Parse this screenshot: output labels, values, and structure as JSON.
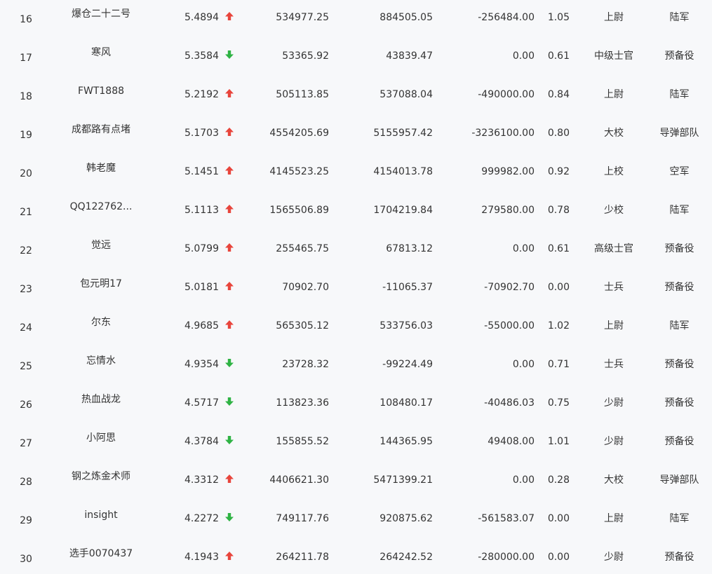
{
  "colors": {
    "up": "#e8453c",
    "down": "#2fb344",
    "text": "#333333",
    "background": "#f7f8fa"
  },
  "rows": [
    {
      "rank": "16",
      "name": "爆仓二十二号",
      "ratio": "5.4894",
      "trend": "up",
      "v1": "534977.25",
      "v2": "884505.05",
      "v3": "-256484.00",
      "v4": "1.05",
      "military_rank": "上尉",
      "branch": "陆军"
    },
    {
      "rank": "17",
      "name": "寒风",
      "ratio": "5.3584",
      "trend": "down",
      "v1": "53365.92",
      "v2": "43839.47",
      "v3": "0.00",
      "v4": "0.61",
      "military_rank": "中级士官",
      "branch": "预备役"
    },
    {
      "rank": "18",
      "name": "FWT1888",
      "ratio": "5.2192",
      "trend": "up",
      "v1": "505113.85",
      "v2": "537088.04",
      "v3": "-490000.00",
      "v4": "0.84",
      "military_rank": "上尉",
      "branch": "陆军"
    },
    {
      "rank": "19",
      "name": "成都路有点堵",
      "ratio": "5.1703",
      "trend": "up",
      "v1": "4554205.69",
      "v2": "5155957.42",
      "v3": "-3236100.00",
      "v4": "0.80",
      "military_rank": "大校",
      "branch": "导弹部队"
    },
    {
      "rank": "20",
      "name": "韩老魔",
      "ratio": "5.1451",
      "trend": "up",
      "v1": "4145523.25",
      "v2": "4154013.78",
      "v3": "999982.00",
      "v4": "0.92",
      "military_rank": "上校",
      "branch": "空军"
    },
    {
      "rank": "21",
      "name": "QQ122762...",
      "ratio": "5.1113",
      "trend": "up",
      "v1": "1565506.89",
      "v2": "1704219.84",
      "v3": "279580.00",
      "v4": "0.78",
      "military_rank": "少校",
      "branch": "陆军"
    },
    {
      "rank": "22",
      "name": "觉远",
      "ratio": "5.0799",
      "trend": "up",
      "v1": "255465.75",
      "v2": "67813.12",
      "v3": "0.00",
      "v4": "0.61",
      "military_rank": "高级士官",
      "branch": "预备役"
    },
    {
      "rank": "23",
      "name": "包元明17",
      "ratio": "5.0181",
      "trend": "up",
      "v1": "70902.70",
      "v2": "-11065.37",
      "v3": "-70902.70",
      "v4": "0.00",
      "military_rank": "士兵",
      "branch": "预备役"
    },
    {
      "rank": "24",
      "name": "尔东",
      "ratio": "4.9685",
      "trend": "up",
      "v1": "565305.12",
      "v2": "533756.03",
      "v3": "-55000.00",
      "v4": "1.02",
      "military_rank": "上尉",
      "branch": "陆军"
    },
    {
      "rank": "25",
      "name": "忘情水",
      "ratio": "4.9354",
      "trend": "down",
      "v1": "23728.32",
      "v2": "-99224.49",
      "v3": "0.00",
      "v4": "0.71",
      "military_rank": "士兵",
      "branch": "预备役"
    },
    {
      "rank": "26",
      "name": "热血战龙",
      "ratio": "4.5717",
      "trend": "down",
      "v1": "113823.36",
      "v2": "108480.17",
      "v3": "-40486.03",
      "v4": "0.75",
      "military_rank": "少尉",
      "branch": "预备役"
    },
    {
      "rank": "27",
      "name": "小阿思",
      "ratio": "4.3784",
      "trend": "down",
      "v1": "155855.52",
      "v2": "144365.95",
      "v3": "49408.00",
      "v4": "1.01",
      "military_rank": "少尉",
      "branch": "预备役"
    },
    {
      "rank": "28",
      "name": "钢之炼金术师",
      "ratio": "4.3312",
      "trend": "up",
      "v1": "4406621.30",
      "v2": "5471399.21",
      "v3": "0.00",
      "v4": "0.28",
      "military_rank": "大校",
      "branch": "导弹部队"
    },
    {
      "rank": "29",
      "name": "insight",
      "ratio": "4.2272",
      "trend": "down",
      "v1": "749117.76",
      "v2": "920875.62",
      "v3": "-561583.07",
      "v4": "0.00",
      "military_rank": "上尉",
      "branch": "陆军"
    },
    {
      "rank": "30",
      "name": "选手0070437",
      "ratio": "4.1943",
      "trend": "up",
      "v1": "264211.78",
      "v2": "264242.52",
      "v3": "-280000.00",
      "v4": "0.00",
      "military_rank": "少尉",
      "branch": "预备役"
    }
  ]
}
